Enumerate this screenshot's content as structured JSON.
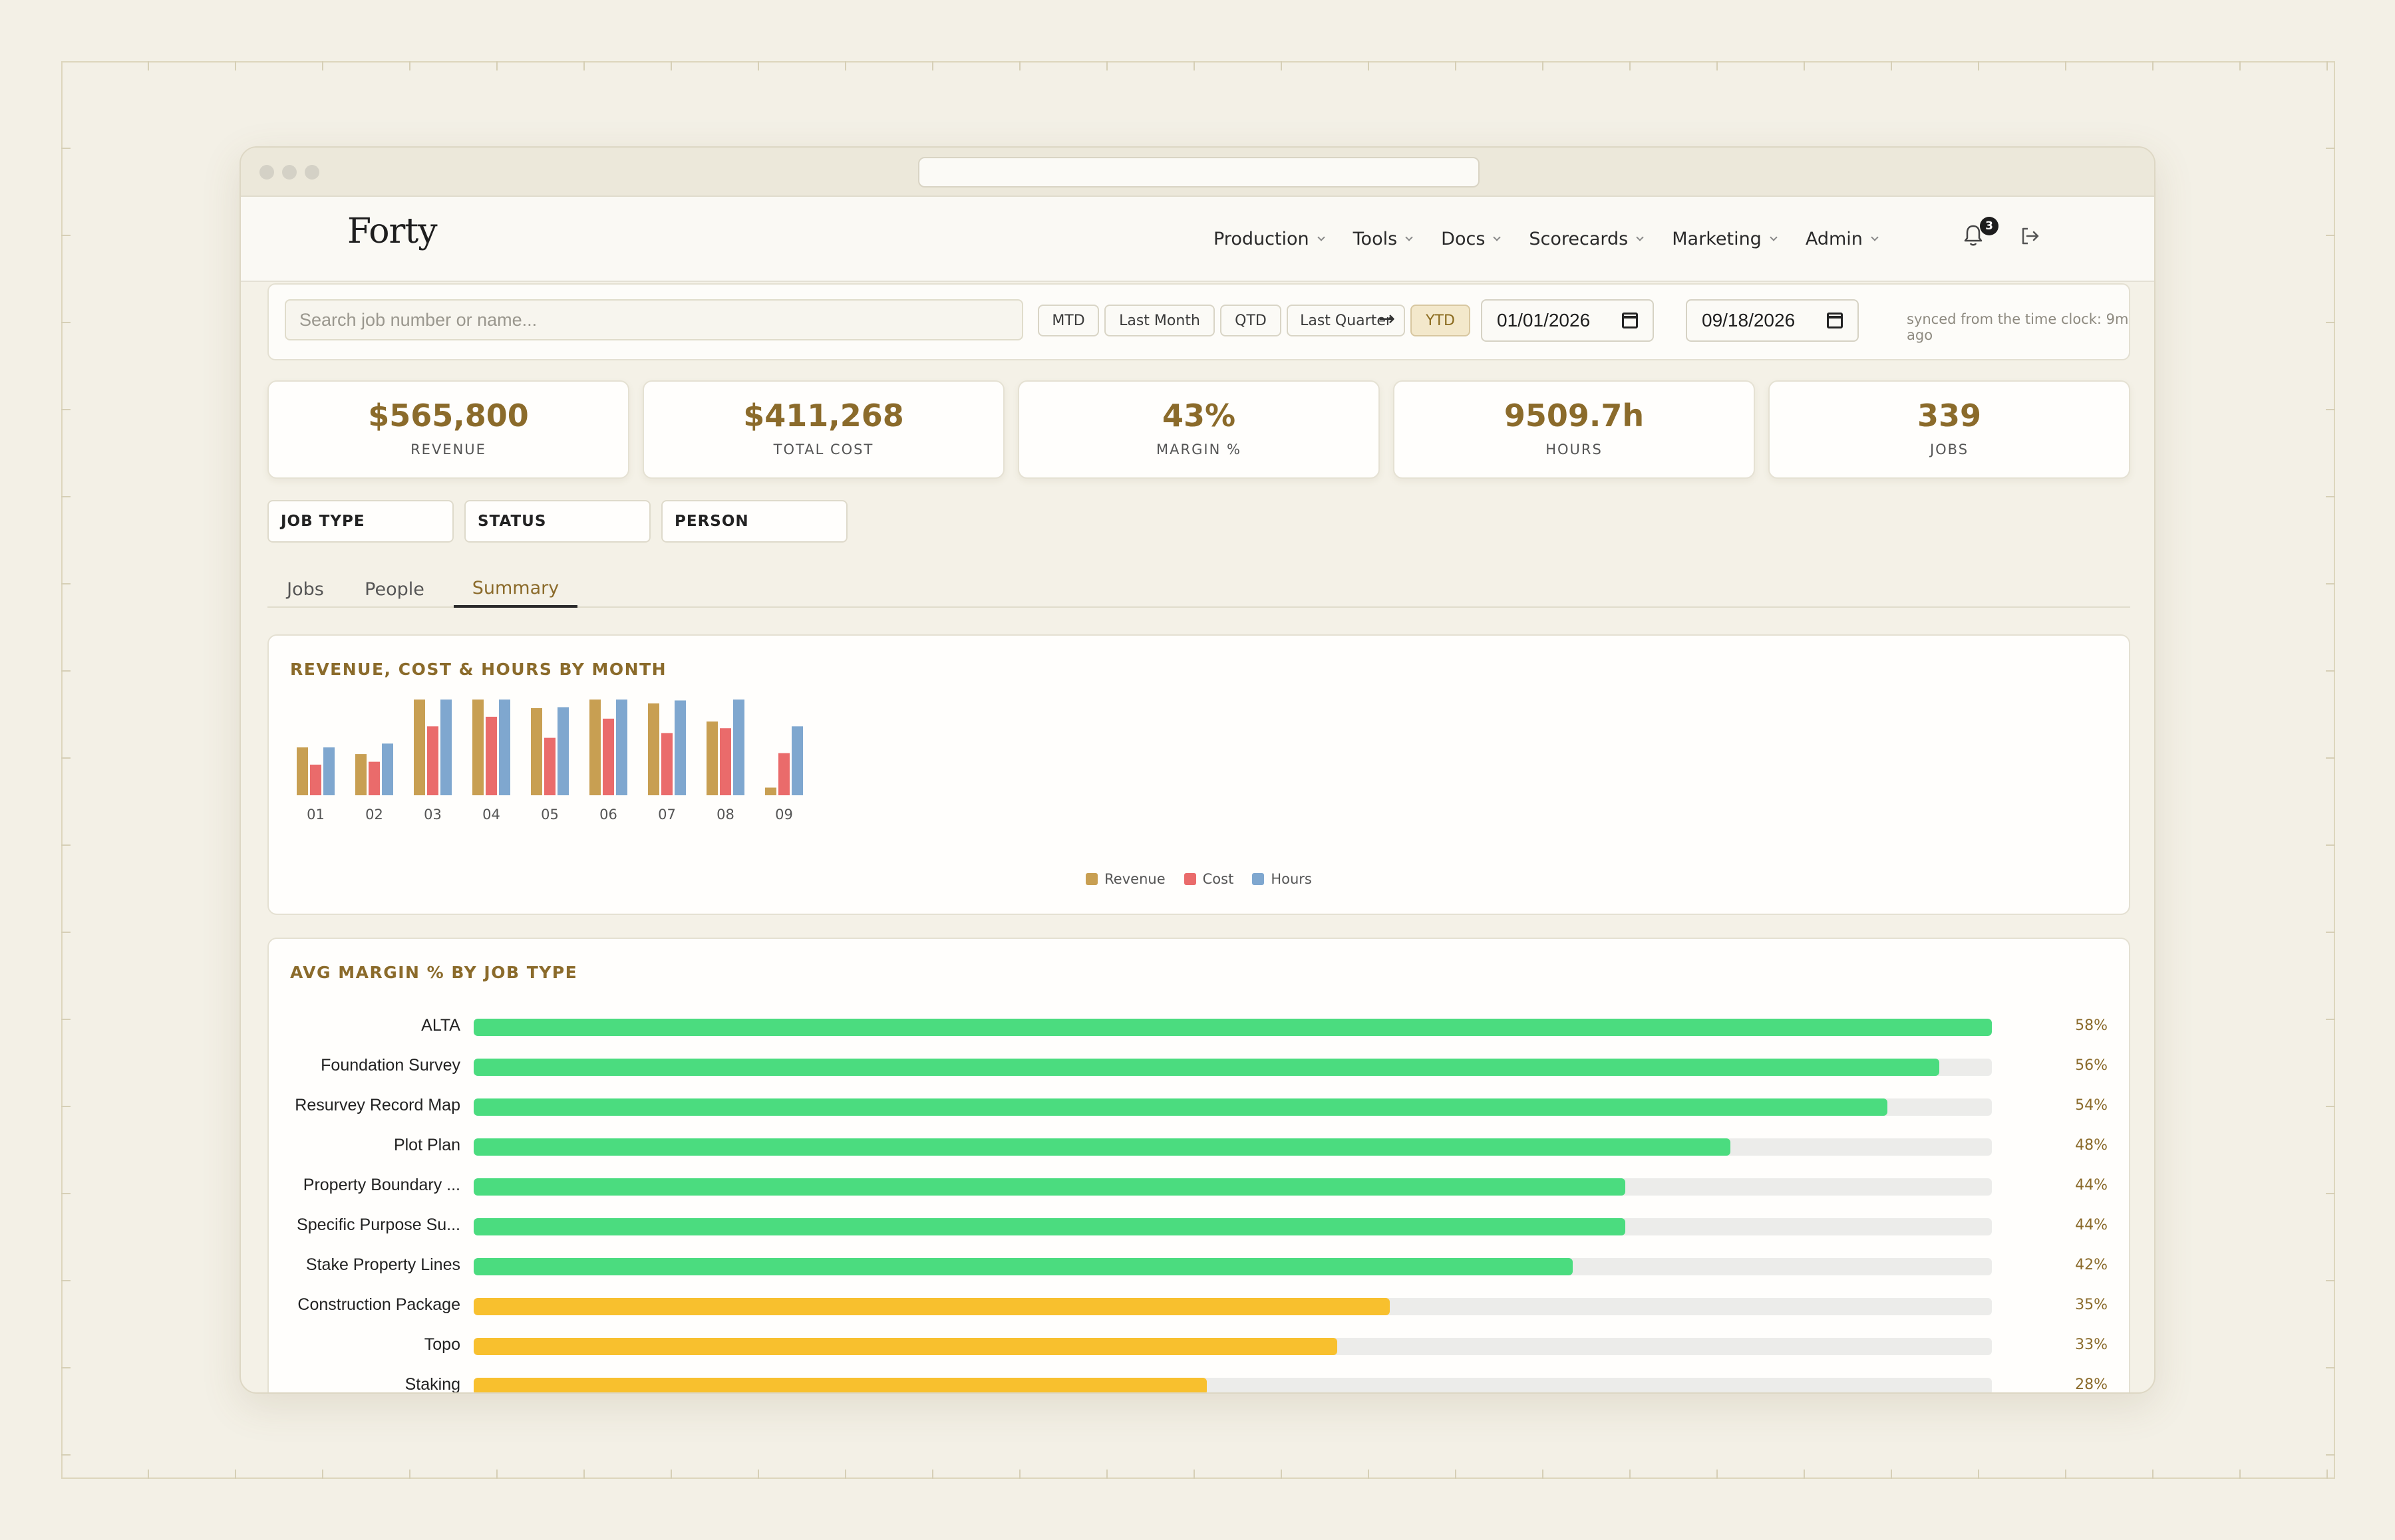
{
  "app": {
    "logo": "Forty"
  },
  "nav": {
    "items": [
      {
        "label": "Production",
        "key": "production"
      },
      {
        "label": "Tools",
        "key": "tools"
      },
      {
        "label": "Docs",
        "key": "docs"
      },
      {
        "label": "Scorecards",
        "key": "scorecards"
      },
      {
        "label": "Marketing",
        "key": "marketing"
      },
      {
        "label": "Admin",
        "key": "admin"
      }
    ],
    "notifications_count": "3"
  },
  "filters": {
    "search_placeholder": "Search job number or name...",
    "period_buttons": [
      "MTD",
      "Last Month",
      "QTD",
      "Last Quarter",
      "YTD"
    ],
    "active_period": "YTD",
    "date_from": "01/01/2026",
    "date_to": "09/18/2026",
    "arrow": "→",
    "synced_text": "synced from the time clock: 9m ago"
  },
  "kpis": [
    {
      "value": "$565,800",
      "label": "REVENUE"
    },
    {
      "value": "$411,268",
      "label": "TOTAL COST"
    },
    {
      "value": "43%",
      "label": "MARGIN %"
    },
    {
      "value": "9509.7h",
      "label": "HOURS"
    },
    {
      "value": "339",
      "label": "JOBS"
    }
  ],
  "filter_buttons": [
    "JOB TYPE",
    "STATUS",
    "PERSON"
  ],
  "tabs": {
    "items": [
      "Jobs",
      "People",
      "Summary"
    ],
    "active": "Summary"
  },
  "colors": {
    "revenue": "#c89f52",
    "cost": "#ea6b6b",
    "hours": "#7fa7cf",
    "margin_high": "#4bdc7f",
    "margin_mid": "#f8c02e",
    "accent": "#8b6b2b"
  },
  "chart_data": [
    {
      "type": "bar",
      "title": "REVENUE, COST & HOURS BY MONTH",
      "categories": [
        "01",
        "02",
        "03",
        "04",
        "05",
        "06",
        "07",
        "08",
        "09"
      ],
      "series": [
        {
          "name": "Revenue",
          "values": [
            50,
            43,
            100,
            100,
            91,
            100,
            96,
            77,
            8
          ]
        },
        {
          "name": "Cost",
          "values": [
            32,
            35,
            72,
            82,
            60,
            80,
            65,
            70,
            44
          ]
        },
        {
          "name": "Hours",
          "values": [
            50,
            54,
            100,
            100,
            92,
            100,
            99,
            100,
            72
          ]
        }
      ],
      "ylim": [
        0,
        100
      ],
      "legend": "bottom-center"
    },
    {
      "type": "bar",
      "orientation": "horizontal",
      "title": "AVG MARGIN % BY JOB TYPE",
      "categories": [
        "ALTA",
        "Foundation Survey",
        "Resurvey Record Map",
        "Plot Plan",
        "Property Boundary ...",
        "Specific Purpose Su...",
        "Stake Property Lines",
        "Construction Package",
        "Topo",
        "Staking"
      ],
      "values": [
        58,
        56,
        54,
        48,
        44,
        44,
        42,
        35,
        33,
        28
      ],
      "value_labels": [
        "58%",
        "56%",
        "54%",
        "48%",
        "44%",
        "44%",
        "42%",
        "35%",
        "33%",
        "28%"
      ],
      "xlim": [
        0,
        58
      ]
    }
  ]
}
